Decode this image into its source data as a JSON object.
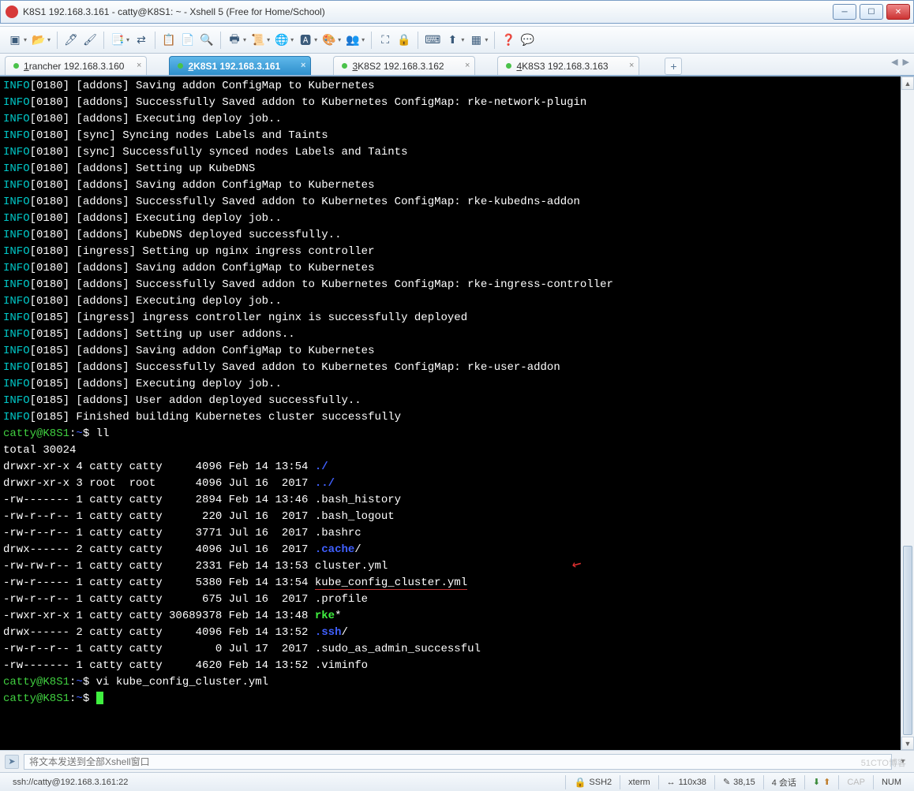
{
  "window": {
    "title": "K8S1 192.168.3.161 - catty@K8S1: ~ - Xshell 5 (Free for Home/School)"
  },
  "tabs": [
    {
      "num": "1",
      "label": "rancher 192.168.3.160",
      "active": false
    },
    {
      "num": "2",
      "label": "K8S1 192.168.3.161",
      "active": true
    },
    {
      "num": "3",
      "label": "K8S2 192.168.3.162",
      "active": false
    },
    {
      "num": "4",
      "label": "K8S3 192.168.3.163",
      "active": false
    }
  ],
  "terminal": {
    "info_label": "INFO",
    "logs": [
      {
        "ts": "[0180]",
        "msg": "[addons] Saving addon ConfigMap to Kubernetes"
      },
      {
        "ts": "[0180]",
        "msg": "[addons] Successfully Saved addon to Kubernetes ConfigMap: rke-network-plugin"
      },
      {
        "ts": "[0180]",
        "msg": "[addons] Executing deploy job.."
      },
      {
        "ts": "[0180]",
        "msg": "[sync] Syncing nodes Labels and Taints"
      },
      {
        "ts": "[0180]",
        "msg": "[sync] Successfully synced nodes Labels and Taints"
      },
      {
        "ts": "[0180]",
        "msg": "[addons] Setting up KubeDNS"
      },
      {
        "ts": "[0180]",
        "msg": "[addons] Saving addon ConfigMap to Kubernetes"
      },
      {
        "ts": "[0180]",
        "msg": "[addons] Successfully Saved addon to Kubernetes ConfigMap: rke-kubedns-addon"
      },
      {
        "ts": "[0180]",
        "msg": "[addons] Executing deploy job.."
      },
      {
        "ts": "[0180]",
        "msg": "[addons] KubeDNS deployed successfully.."
      },
      {
        "ts": "[0180]",
        "msg": "[ingress] Setting up nginx ingress controller"
      },
      {
        "ts": "[0180]",
        "msg": "[addons] Saving addon ConfigMap to Kubernetes"
      },
      {
        "ts": "[0180]",
        "msg": "[addons] Successfully Saved addon to Kubernetes ConfigMap: rke-ingress-controller"
      },
      {
        "ts": "[0180]",
        "msg": "[addons] Executing deploy job.."
      },
      {
        "ts": "[0185]",
        "msg": "[ingress] ingress controller nginx is successfully deployed"
      },
      {
        "ts": "[0185]",
        "msg": "[addons] Setting up user addons.."
      },
      {
        "ts": "[0185]",
        "msg": "[addons] Saving addon ConfigMap to Kubernetes"
      },
      {
        "ts": "[0185]",
        "msg": "[addons] Successfully Saved addon to Kubernetes ConfigMap: rke-user-addon"
      },
      {
        "ts": "[0185]",
        "msg": "[addons] Executing deploy job.."
      },
      {
        "ts": "[0185]",
        "msg": "[addons] User addon deployed successfully.."
      },
      {
        "ts": "[0185]",
        "msg": "Finished building Kubernetes cluster successfully"
      }
    ],
    "prompt1_host": "catty@K8S1",
    "prompt1_path": "~",
    "prompt1_cmd": "ll",
    "total_line": "total 30024",
    "ls": [
      {
        "perm": "drwxr-xr-x",
        "n": "4",
        "own": "catty",
        "grp": "catty",
        "size": "4096",
        "date": "Feb 14 13:54",
        "name": "./",
        "cls": "t-blueb"
      },
      {
        "perm": "drwxr-xr-x",
        "n": "3",
        "own": "root ",
        "grp": "root ",
        "size": "4096",
        "date": "Jul 16  2017",
        "name": "../",
        "cls": "t-blueb"
      },
      {
        "perm": "-rw-------",
        "n": "1",
        "own": "catty",
        "grp": "catty",
        "size": "2894",
        "date": "Feb 14 13:46",
        "name": ".bash_history",
        "cls": ""
      },
      {
        "perm": "-rw-r--r--",
        "n": "1",
        "own": "catty",
        "grp": "catty",
        "size": "220",
        "date": "Jul 16  2017",
        "name": ".bash_logout",
        "cls": ""
      },
      {
        "perm": "-rw-r--r--",
        "n": "1",
        "own": "catty",
        "grp": "catty",
        "size": "3771",
        "date": "Jul 16  2017",
        "name": ".bashrc",
        "cls": ""
      },
      {
        "perm": "drwx------",
        "n": "2",
        "own": "catty",
        "grp": "catty",
        "size": "4096",
        "date": "Jul 16  2017",
        "name": ".cache",
        "suffix": "/",
        "cls": "t-blueb"
      },
      {
        "perm": "-rw-rw-r--",
        "n": "1",
        "own": "catty",
        "grp": "catty",
        "size": "2331",
        "date": "Feb 14 13:53",
        "name": "cluster.yml",
        "cls": ""
      },
      {
        "perm": "-rw-r-----",
        "n": "1",
        "own": "catty",
        "grp": "catty",
        "size": "5380",
        "date": "Feb 14 13:54",
        "name": "kube_config_cluster.yml",
        "cls": "",
        "underline": true
      },
      {
        "perm": "-rw-r--r--",
        "n": "1",
        "own": "catty",
        "grp": "catty",
        "size": "675",
        "date": "Jul 16  2017",
        "name": ".profile",
        "cls": ""
      },
      {
        "perm": "-rwxr-xr-x",
        "n": "1",
        "own": "catty",
        "grp": "catty",
        "size": "30689378",
        "date": "Feb 14 13:48",
        "name": "rke",
        "suffix": "*",
        "cls": "t-greenb"
      },
      {
        "perm": "drwx------",
        "n": "2",
        "own": "catty",
        "grp": "catty",
        "size": "4096",
        "date": "Feb 14 13:52",
        "name": ".ssh",
        "suffix": "/",
        "cls": "t-blueb"
      },
      {
        "perm": "-rw-r--r--",
        "n": "1",
        "own": "catty",
        "grp": "catty",
        "size": "0",
        "date": "Jul 17  2017",
        "name": ".sudo_as_admin_successful",
        "cls": ""
      },
      {
        "perm": "-rw-------",
        "n": "1",
        "own": "catty",
        "grp": "catty",
        "size": "4620",
        "date": "Feb 14 13:52",
        "name": ".viminfo",
        "cls": ""
      }
    ],
    "prompt2_cmd": "vi kube_config_cluster.yml",
    "prompt3_cmd": ""
  },
  "sendbar": {
    "placeholder": "将文本发送到全部Xshell窗口"
  },
  "status": {
    "conn": "ssh://catty@192.168.3.161:22",
    "ssh": "SSH2",
    "term": "xterm",
    "size": "110x38",
    "pos": "38,15",
    "sessions": "4 会话",
    "cap": "CAP",
    "num": "NUM"
  },
  "watermark": "51CTO博客"
}
